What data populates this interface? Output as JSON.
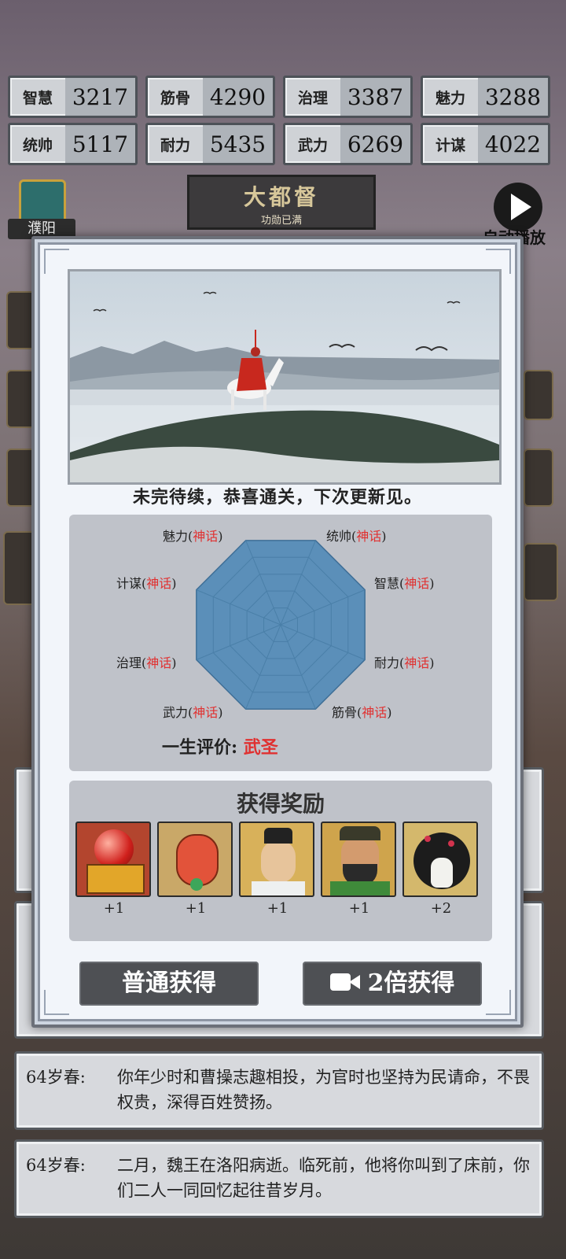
{
  "stats": [
    {
      "name": "智慧",
      "value": "3217"
    },
    {
      "name": "筋骨",
      "value": "4290"
    },
    {
      "name": "治理",
      "value": "3387"
    },
    {
      "name": "魅力",
      "value": "3288"
    },
    {
      "name": "统帅",
      "value": "5117"
    },
    {
      "name": "耐力",
      "value": "5435"
    },
    {
      "name": "武力",
      "value": "6269"
    },
    {
      "name": "计谋",
      "value": "4022"
    }
  ],
  "rank": {
    "title": "大都督",
    "subtitle": "功勋已满"
  },
  "city": {
    "name": "濮阳"
  },
  "auto_play": {
    "label": "自动播放"
  },
  "modal": {
    "caption": "未完待续，恭喜通关，下次更新见。",
    "attributes": [
      {
        "name": "魅力",
        "level": "神话"
      },
      {
        "name": "统帅",
        "level": "神话"
      },
      {
        "name": "计谋",
        "level": "神话"
      },
      {
        "name": "智慧",
        "level": "神话"
      },
      {
        "name": "治理",
        "level": "神话"
      },
      {
        "name": "耐力",
        "level": "神话"
      },
      {
        "name": "武力",
        "level": "神话"
      },
      {
        "name": "筋骨",
        "level": "神话"
      }
    ],
    "life_eval_label": "一生评价:",
    "life_eval_value": "武圣",
    "reward_title": "获得奖励",
    "rewards": [
      {
        "icon": "red-orb-chest-icon",
        "count": "+1"
      },
      {
        "icon": "red-lantern-icon",
        "count": "+1"
      },
      {
        "icon": "scholar-general-portrait",
        "count": "+1"
      },
      {
        "icon": "bearded-general-portrait",
        "count": "+1"
      },
      {
        "icon": "plum-vase-icon",
        "count": "+2"
      }
    ],
    "btn_normal": "普通获得",
    "btn_double": "2倍获得"
  },
  "logs": [
    {
      "age": "64岁春:",
      "text": "你年少时和曹操志趣相投，为官时也坚持为民请命，不畏权贵，深得百姓赞扬。"
    },
    {
      "age": "64岁春:",
      "text": "二月，魏王在洛阳病逝。临死前，他将你叫到了床前，你们二人一同回忆起往昔岁月。"
    }
  ],
  "colors": {
    "accent_red": "#e03131",
    "panel": "#bfc2c9",
    "radar_fill": "#5b8fb9"
  }
}
